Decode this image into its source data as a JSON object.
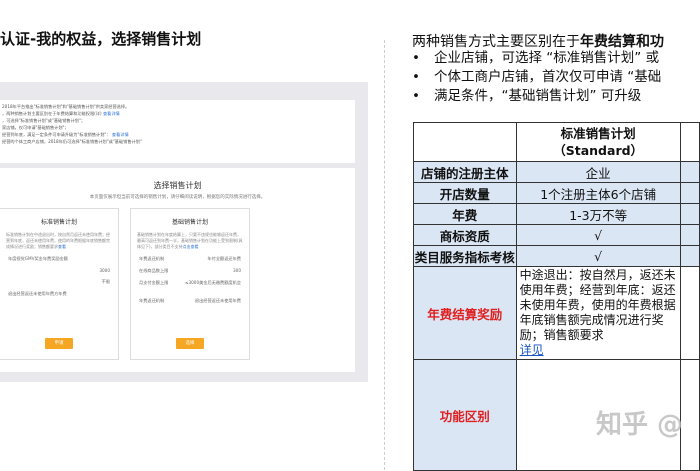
{
  "left": {
    "title": "认证-我的权益，选择销售计划",
    "screenshot": {
      "top_lines": [
        {
          "text": "2018年平台推出\"标准销售计划\"和\"基础销售计划\"供卖家经营选择。",
          "link": ""
        },
        {
          "text": "，两种销售计划主要区别在于年费结算和功能权限(详)",
          "link": "查看详情"
        },
        {
          "text": "，可选择\"标准销售计划\"或\"基础销售计划\"；",
          "link": ""
        },
        {
          "text": "家店铺，仅可申请\"基础销售计划\"；",
          "link": ""
        },
        {
          "text": "经营到年底，满足一定条件可申请升级为\"标准销售计划\"：",
          "link": "查看详情"
        },
        {
          "text": "经营的个体工商户店铺，2018年仍可选择\"标准销售计划\"或\"基础销售计划\"",
          "link": ""
        }
      ],
      "select_title": "选择销售计划",
      "select_sub": "本页面仅展示但当前可选择的销售计划，请仔细阅读说明，根据您的实际情况进行选择。",
      "plans": [
        {
          "name": "标准销售计划",
          "desc": "标准销售计划在中途退出时，按自然月返还未使用年费；经营到年底，返还未使用年费，使用的年费根据年底销售额完成情况进行奖励；销售额要求",
          "desc_link": "查看",
          "rows": [
            {
              "k": "年度视觉GMV奖金年费奖励金额",
              "v": ""
            },
            {
              "k": "",
              "v": "3000"
            },
            {
              "k": "",
              "v": "不限"
            },
            {
              "k": "退出经营返还未使用年费方年费",
              "v": ""
            }
          ],
          "apply": "申请"
        },
        {
          "name": "基础销售计划",
          "desc": "基础销售计划在年度结算上，只要不违规也能够返还年费，最高可返还到年费一半，基础销售计划在功能上受到限制(具体见下)，部分类目不支持",
          "desc_link": "点击查看",
          "rows": [
            {
              "k": "年费返还机制",
              "v": "年付全额返还年费"
            },
            {
              "k": "在线商品数上限",
              "v": "300"
            },
            {
              "k": "月支付金额上限",
              "v": "≤3000美金后无缴费额度机会"
            },
            {
              "k": "",
              "v": ""
            },
            {
              "k": "年费返还机制",
              "v": "退出经营返还未使用年费"
            }
          ],
          "apply": "选择"
        }
      ]
    }
  },
  "right": {
    "headline_normal": "两种销售方式主要区别在于",
    "headline_bold": "年费结算和功",
    "bullets": [
      "企业店铺，可选择 “标准销售计划” 或",
      "个体工商户店铺，首次仅可申请 “基础",
      "满足条件，“基础销售计划” 可升级"
    ],
    "table": {
      "std_name": "标准销售计划",
      "std_sub": "（Standard）",
      "rows": [
        {
          "label": "店铺的注册主体",
          "value": "企业"
        },
        {
          "label": "开店数量",
          "value": "1个注册主体6个店铺"
        },
        {
          "label": "年费",
          "value": "1-3万不等"
        },
        {
          "label": "商标资质",
          "value": "√"
        },
        {
          "label": "类目服务指标考核",
          "value": "√"
        }
      ],
      "reward_label": "年费结算奖励",
      "reward_text": "中途退出：按自然月，返还未使用年费；经营到年底：返还未使用年费，使用的年费根据年底销售额完成情况进行奖励；销售额要求",
      "reward_link": "详见",
      "feature_label": "功能区别",
      "feature_text": ""
    },
    "watermark": "知乎 @"
  }
}
